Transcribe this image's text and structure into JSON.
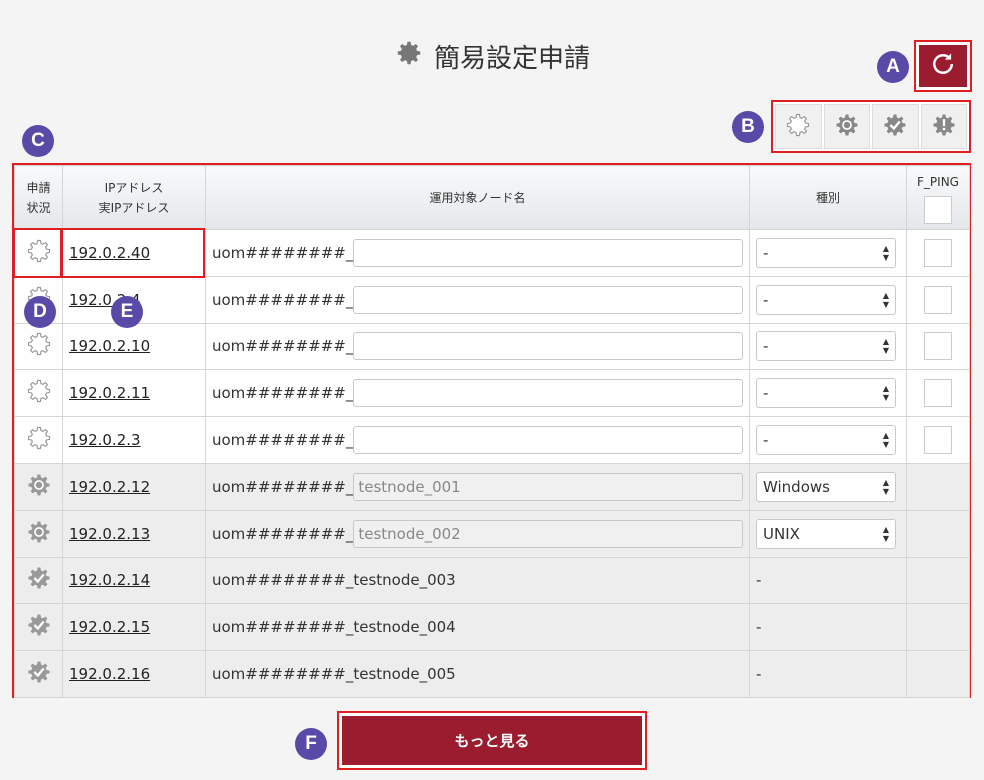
{
  "title": "簡易設定申請",
  "markers": {
    "a": "A",
    "b": "B",
    "c": "C",
    "d": "D",
    "e": "E",
    "f": "F"
  },
  "icons": {
    "title": "gear-icon",
    "refresh": "refresh-icon"
  },
  "filters": [
    "gear-outline-icon",
    "gear-sync-icon",
    "gear-check-icon",
    "gear-alert-icon"
  ],
  "table": {
    "headers": {
      "status": [
        "申請",
        "状況"
      ],
      "ip": [
        "IPアドレス",
        "実IPアドレス"
      ],
      "node": "運用対象ノード名",
      "type": "種別",
      "fping": "F_PING"
    },
    "rows": [
      {
        "status": "pending",
        "ip": "192.0.2.40",
        "prefix": "uom########_",
        "node": "",
        "type": "-",
        "fping": true
      },
      {
        "status": "pending",
        "ip": "192.0.2.4",
        "prefix": "uom########_",
        "node": "",
        "type": "-",
        "fping": true
      },
      {
        "status": "pending",
        "ip": "192.0.2.10",
        "prefix": "uom########_",
        "node": "",
        "type": "-",
        "fping": true
      },
      {
        "status": "pending",
        "ip": "192.0.2.11",
        "prefix": "uom########_",
        "node": "",
        "type": "-",
        "fping": true
      },
      {
        "status": "pending",
        "ip": "192.0.2.3",
        "prefix": "uom########_",
        "node": "",
        "type": "-",
        "fping": true
      },
      {
        "status": "processing",
        "ip": "192.0.2.12",
        "prefix": "uom########_",
        "node": "testnode_001",
        "type": "Windows",
        "fping": false
      },
      {
        "status": "processing",
        "ip": "192.0.2.13",
        "prefix": "uom########_",
        "node": "testnode_002",
        "type": "UNIX",
        "fping": false
      },
      {
        "status": "done",
        "ip": "192.0.2.14",
        "prefix": "uom########_",
        "node": "testnode_003",
        "type": "-",
        "fping": false
      },
      {
        "status": "done",
        "ip": "192.0.2.15",
        "prefix": "uom########_",
        "node": "testnode_004",
        "type": "-",
        "fping": false
      },
      {
        "status": "done",
        "ip": "192.0.2.16",
        "prefix": "uom########_",
        "node": "testnode_005",
        "type": "-",
        "fping": false
      }
    ]
  },
  "more_button": "もっと見る",
  "colors": {
    "accent": "#9b1c2e",
    "highlight": "#e02020",
    "marker": "#5a4aa8"
  }
}
